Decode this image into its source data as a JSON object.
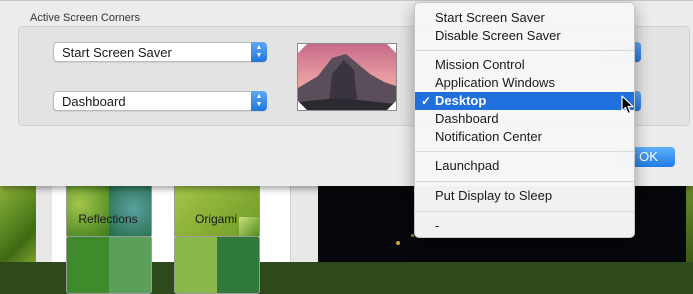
{
  "sheet": {
    "group_title": "Active Screen Corners",
    "top_left_popup": "Start Screen Saver",
    "bottom_left_popup": "Dashboard",
    "ok_button": "OK"
  },
  "menu": {
    "sections": [
      [
        "Start Screen Saver",
        "Disable Screen Saver"
      ],
      [
        "Mission Control",
        "Application Windows",
        "Desktop",
        "Dashboard",
        "Notification Center"
      ],
      [
        "Launchpad"
      ],
      [
        "Put Display to Sleep"
      ],
      [
        "-"
      ]
    ],
    "selected": "Desktop",
    "checkmark": "✓"
  },
  "background": {
    "thumbnails": [
      {
        "label": "Reflections"
      },
      {
        "label": "Origami"
      }
    ]
  },
  "colors": {
    "accent": "#1f6fdc",
    "sheet_bg": "#ececec"
  }
}
